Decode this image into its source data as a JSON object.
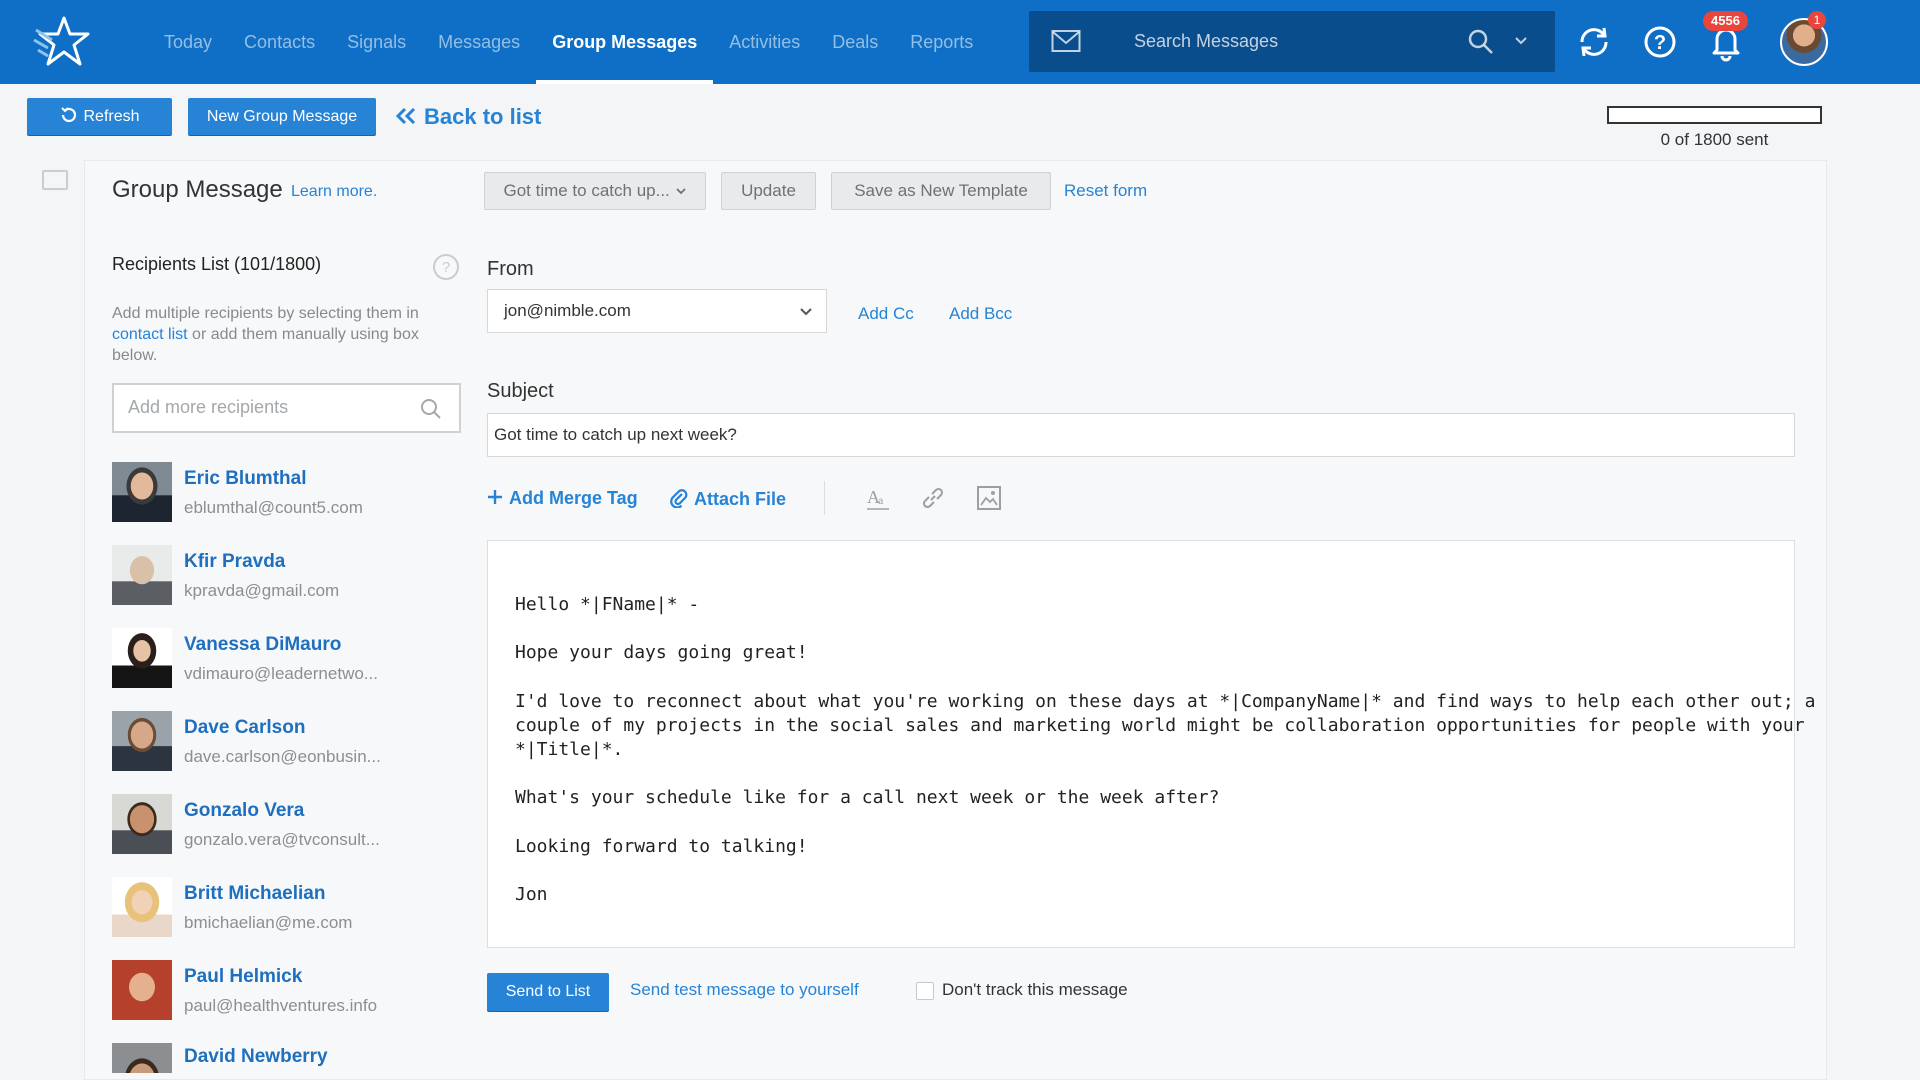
{
  "nav": {
    "items": [
      {
        "label": "Today"
      },
      {
        "label": "Contacts"
      },
      {
        "label": "Signals"
      },
      {
        "label": "Messages"
      },
      {
        "label": "Group Messages",
        "active": true
      },
      {
        "label": "Activities"
      },
      {
        "label": "Deals"
      },
      {
        "label": "Reports"
      }
    ],
    "search_placeholder": "Search Messages",
    "notification_count": "4556",
    "avatar_badge": "1"
  },
  "toolbar": {
    "refresh_label": "Refresh",
    "new_label": "New Group Message",
    "back_label": "Back to list",
    "progress_text": "0 of 1800 sent",
    "progress_fraction": 0
  },
  "header": {
    "title": "Group Message",
    "learn_more": "Learn more.",
    "template_select": "Got time to catch up...",
    "update_label": "Update",
    "save_template_label": "Save as New Template",
    "reset_label": "Reset form"
  },
  "recipients": {
    "title": "Recipients List (101/1800)",
    "desc_before": "Add multiple recipients by selecting them in ",
    "desc_link": "contact list",
    "desc_after": " or add them manually using box below.",
    "placeholder": "Add more recipients",
    "contacts": [
      {
        "name": "Eric Blumthal",
        "email": "eblumthal@count5.com"
      },
      {
        "name": "Kfir Pravda",
        "email": "kpravda@gmail.com"
      },
      {
        "name": "Vanessa DiMauro",
        "email": "vdimauro@leadernetwo..."
      },
      {
        "name": "Dave Carlson",
        "email": "dave.carlson@eonbusin..."
      },
      {
        "name": "Gonzalo Vera",
        "email": "gonzalo.vera@tvconsult..."
      },
      {
        "name": "Britt Michaelian",
        "email": "bmichaelian@me.com"
      },
      {
        "name": "Paul Helmick",
        "email": "paul@healthventures.info"
      },
      {
        "name": "David Newberry",
        "email": ""
      }
    ]
  },
  "form": {
    "from_label": "From",
    "from_value": "jon@nimble.com",
    "add_cc": "Add Cc",
    "add_bcc": "Add Bcc",
    "subject_label": "Subject",
    "subject_value": "Got time to catch up next week?",
    "add_merge_tag": "Add Merge Tag",
    "attach_file": "Attach File",
    "body": {
      "l1": "Hello *|FName|* -",
      "l2": "Hope your days going great!",
      "l3": "I'd love to reconnect about what you're working on these days at *|CompanyName|* and find ways to help each other out; a",
      "l4": "couple of my projects in the social sales and marketing world might be collaboration opportunities for people with your",
      "l5": "*|Title|*.",
      "l6": "What's your schedule like for a call next week or the week after?",
      "l7": "Looking forward to talking!",
      "l8": "Jon"
    }
  },
  "footer": {
    "send_label": "Send to List",
    "test_label": "Send test message to yourself",
    "dont_track_label": "Don't track this message"
  },
  "colors": {
    "brand_blue": "#0f6fc6",
    "link_blue": "#2683d6",
    "badge_red": "#e8463c"
  }
}
